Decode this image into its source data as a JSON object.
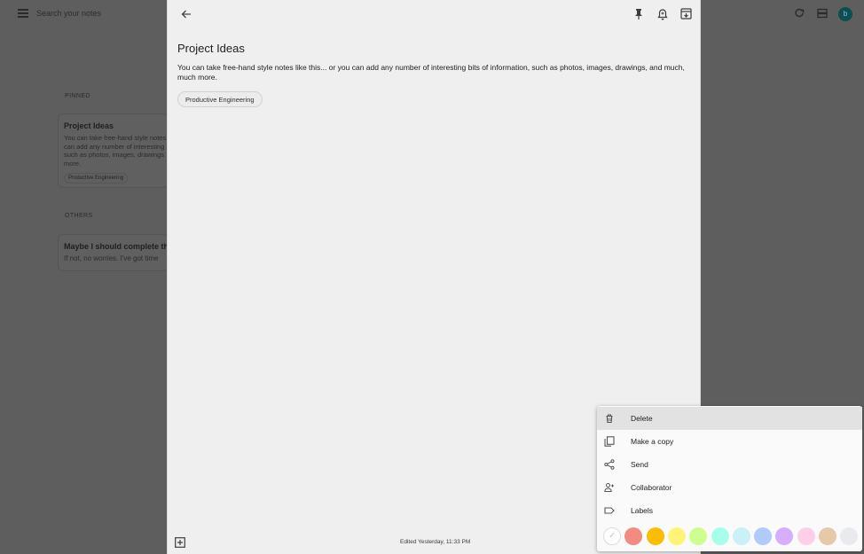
{
  "background": {
    "search_placeholder": "Search your notes",
    "avatar_letter": "b",
    "pinned_label": "PINNED",
    "others_label": "OTHERS",
    "pinned_card": {
      "title": "Project Ideas",
      "body": "You can take free-hand style notes\ncan add any number of interesting\nsuch as photos, images, drawings\nmore.",
      "chip": "Productive Engineering"
    },
    "other_card": {
      "title": "Maybe I should complete thi",
      "body": "If not, no worries. I've got time"
    }
  },
  "editor": {
    "title": "Project Ideas",
    "body": "You can take free-hand style notes like this... or you can add any number of interesting bits of information, such as photos, images, drawings, and much, much more.",
    "label_chip": "Productive Engineering",
    "edited_text": "Edited Yesterday, 11:33 PM"
  },
  "menu": {
    "items": [
      {
        "label": "Delete",
        "icon": "trash-icon"
      },
      {
        "label": "Make a copy",
        "icon": "copy-icon"
      },
      {
        "label": "Send",
        "icon": "share-icon"
      },
      {
        "label": "Collaborator",
        "icon": "add-person-icon"
      },
      {
        "label": "Labels",
        "icon": "label-icon"
      }
    ],
    "colors": [
      "#ffffff",
      "#f28b82",
      "#fbbc04",
      "#fff475",
      "#ccff90",
      "#a7ffeb",
      "#cbf0f8",
      "#aecbfa",
      "#d7aefb",
      "#fdcfe8",
      "#e6c9a8",
      "#e8eaed"
    ]
  }
}
